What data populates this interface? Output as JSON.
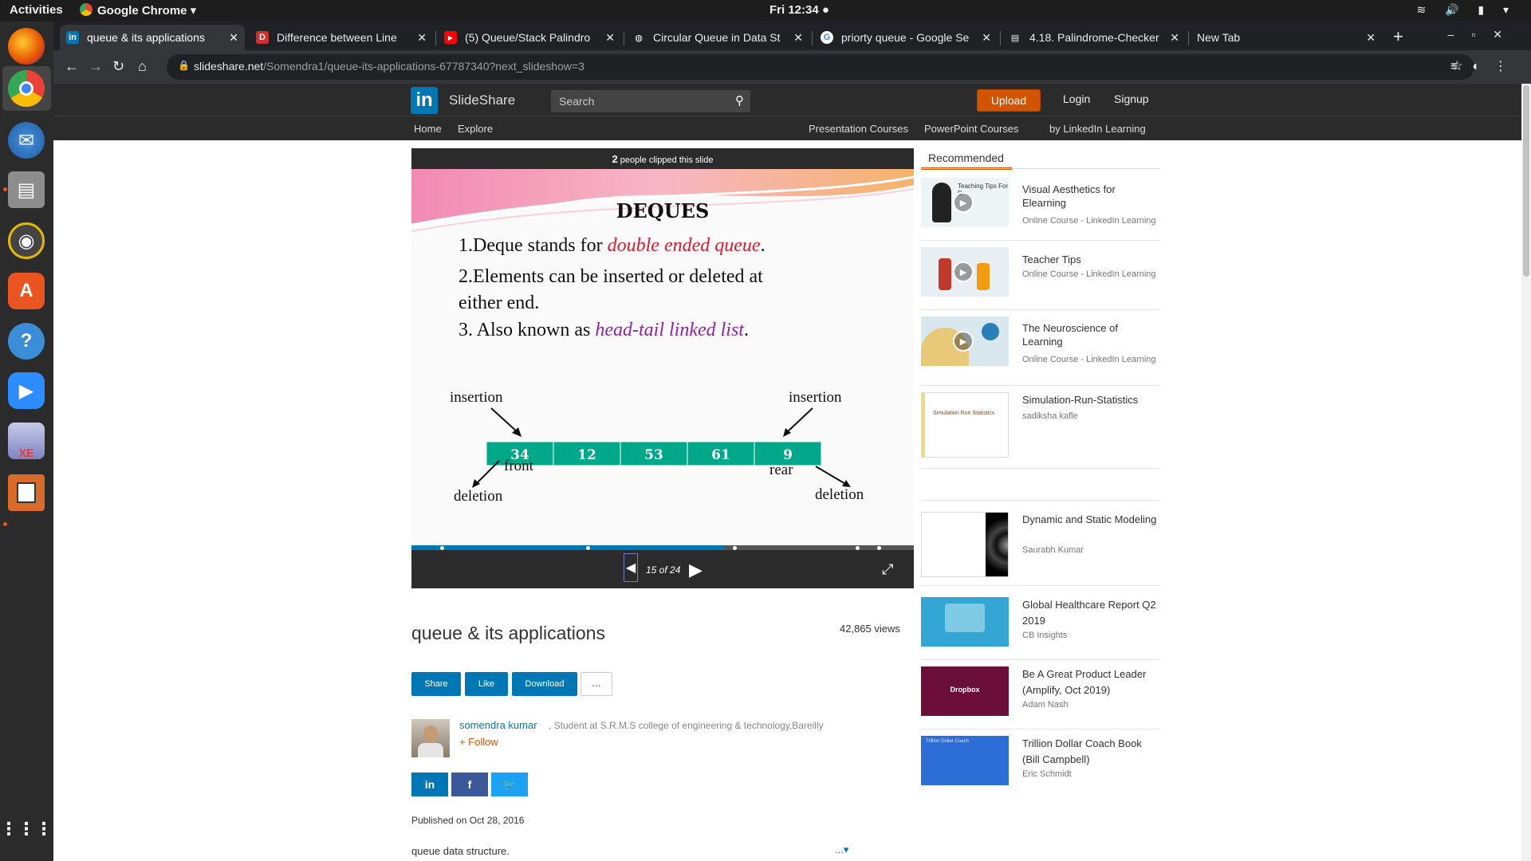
{
  "os": {
    "activities": "Activities",
    "app_name": "Google Chrome",
    "clock": "Fri 12:34 ●",
    "tray": "≋ 🔊 ▮ ▾"
  },
  "dock": {
    "icons": [
      "firefox-icon",
      "chrome-icon",
      "thunderbird-icon",
      "files-icon",
      "rhythmbox-icon",
      "software-icon",
      "help-icon",
      "zoom-icon",
      "database-xe-icon",
      "impress-icon",
      "app-grid-icon"
    ]
  },
  "browser": {
    "tabs": [
      {
        "title": "queue & its applications",
        "favicon": "in"
      },
      {
        "title": "Difference between Line",
        "favicon": "D"
      },
      {
        "title": "(5) Queue/Stack Palindro",
        "favicon": "▶"
      },
      {
        "title": "Circular Queue in Data St",
        "favicon": "◍"
      },
      {
        "title": "priorty queue - Google Se",
        "favicon": "G"
      },
      {
        "title": "4.18. Palindrome-Checker",
        "favicon": "▤"
      },
      {
        "title": "New Tab",
        "favicon": ""
      }
    ],
    "url_domain": "slideshare.net",
    "url_path": "/Somendra1/queue-its-applications-67787340?next_slideshow=3"
  },
  "header": {
    "brand": "SlideShare",
    "search_placeholder": "Search",
    "upload": "Upload",
    "login": "Login",
    "signup": "Signup"
  },
  "subnav": {
    "home": "Home",
    "explore": "Explore",
    "presentation_courses": "Presentation Courses",
    "powerpoint_courses": "PowerPoint Courses",
    "linkedin_learning": "by LinkedIn Learning"
  },
  "player": {
    "clip_count": "2",
    "clip_text": "people clipped this slide",
    "counter": "15 of 24",
    "progress": 0.62
  },
  "slide": {
    "title": "DEQUES",
    "point1_prefix": "1.Deque stands for ",
    "point1_em": "double ended queue",
    "point1_suffix": ".",
    "point2_line1": "2.Elements can be inserted or deleted at",
    "point2_line2": "either end.",
    "point3_prefix": "3. Also known as ",
    "point3_em": "head-tail linked list",
    "point3_suffix": ".",
    "cells": [
      "34",
      "12",
      "53",
      "61",
      "9"
    ],
    "label_insertion_left": "insertion",
    "label_insertion_right": "insertion",
    "label_front": "front",
    "label_rear": "rear",
    "label_deletion_left": "deletion",
    "label_deletion_right": "deletion"
  },
  "info": {
    "title": "queue & its applications",
    "views": "42,865 views",
    "share": "Share",
    "like": "Like",
    "download": "Download",
    "more": "...",
    "author_name": "somendra kumar",
    "author_desc": ", Student at S.R.M.S college of engineering & technology,Bareilly",
    "follow": "+ Follow",
    "published": "Published on Oct 28, 2016",
    "description": "queue data structure.",
    "desc_more": "...▾"
  },
  "recommended": {
    "tab": "Recommended",
    "items": [
      {
        "title": "Visual Aesthetics for Elearning",
        "sub": "Online Course - LinkedIn Learning"
      },
      {
        "title": "Teacher Tips",
        "sub": "Online Course - LinkedIn Learning"
      },
      {
        "title": "The Neuroscience of Learning",
        "sub": "Online Course - LinkedIn Learning"
      },
      {
        "title": "Simulation-Run-Statistics",
        "sub": "sadiksha kafle"
      },
      {
        "title": "Dynamic and Static Modeling",
        "sub": "Saurabh Kumar"
      },
      {
        "title": "Global Healthcare Report Q2 2019",
        "sub": "CB Insights"
      },
      {
        "title": "Be A Great Product Leader (Amplify, Oct 2019)",
        "sub": "Adam Nash"
      },
      {
        "title": "Trillion Dollar Coach Book (Bill Campbell)",
        "sub": "Eric Schmidt"
      }
    ],
    "thumb_texts": {
      "visual": "Teaching Tips For D",
      "sim": "Simulation Run Statistics",
      "dropbox": "Dropbox",
      "coach": "Trillion Dollar Coach"
    }
  }
}
